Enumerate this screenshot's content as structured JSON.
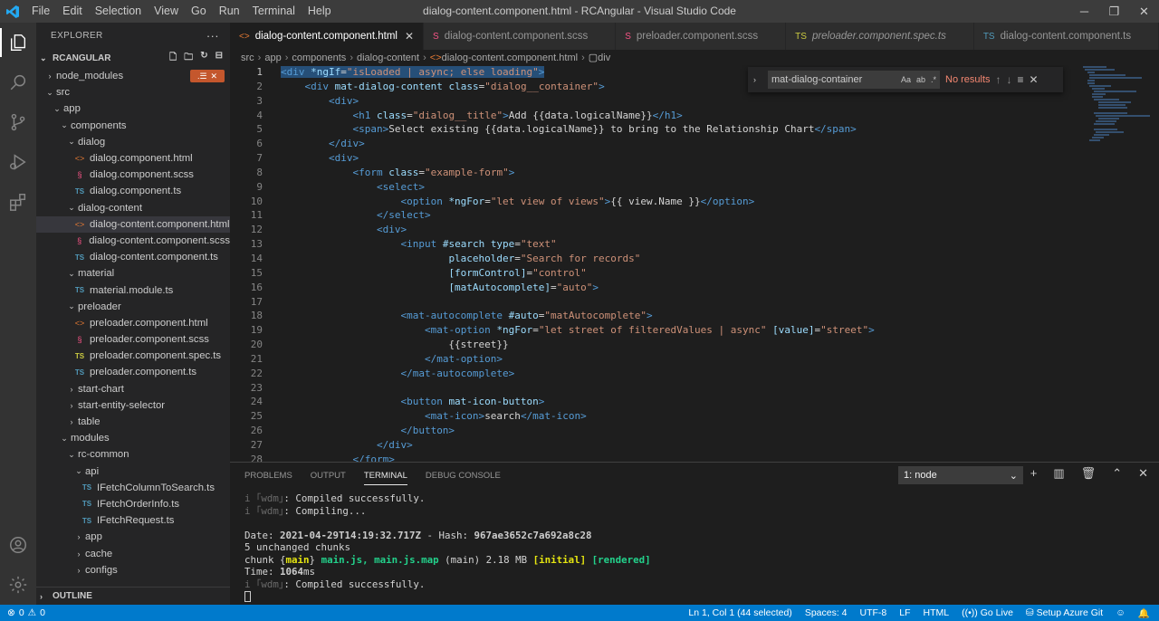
{
  "titlebar": {
    "menu": [
      "File",
      "Edit",
      "Selection",
      "View",
      "Go",
      "Run",
      "Terminal",
      "Help"
    ],
    "title": "dialog-content.component.html - RCAngular - Visual Studio Code"
  },
  "sidebar": {
    "header": "EXPLORER",
    "project": "RCANGULAR",
    "outline": "OUTLINE",
    "badge_count": "",
    "tree": [
      {
        "label": "node_modules",
        "indent": 0,
        "type": "folder",
        "open": false
      },
      {
        "label": "src",
        "indent": 0,
        "type": "folder",
        "open": true
      },
      {
        "label": "app",
        "indent": 1,
        "type": "folder",
        "open": true
      },
      {
        "label": "components",
        "indent": 2,
        "type": "folder",
        "open": true
      },
      {
        "label": "dialog",
        "indent": 3,
        "type": "folder",
        "open": true
      },
      {
        "label": "dialog.component.html",
        "indent": 4,
        "type": "html"
      },
      {
        "label": "dialog.component.scss",
        "indent": 4,
        "type": "scss"
      },
      {
        "label": "dialog.component.ts",
        "indent": 4,
        "type": "ts"
      },
      {
        "label": "dialog-content",
        "indent": 3,
        "type": "folder",
        "open": true
      },
      {
        "label": "dialog-content.component.html",
        "indent": 4,
        "type": "html",
        "selected": true
      },
      {
        "label": "dialog-content.component.scss",
        "indent": 4,
        "type": "scss"
      },
      {
        "label": "dialog-content.component.ts",
        "indent": 4,
        "type": "ts"
      },
      {
        "label": "material",
        "indent": 3,
        "type": "folder",
        "open": true
      },
      {
        "label": "material.module.ts",
        "indent": 4,
        "type": "ts"
      },
      {
        "label": "preloader",
        "indent": 3,
        "type": "folder",
        "open": true
      },
      {
        "label": "preloader.component.html",
        "indent": 4,
        "type": "html"
      },
      {
        "label": "preloader.component.scss",
        "indent": 4,
        "type": "scss"
      },
      {
        "label": "preloader.component.spec.ts",
        "indent": 4,
        "type": "spec"
      },
      {
        "label": "preloader.component.ts",
        "indent": 4,
        "type": "ts"
      },
      {
        "label": "start-chart",
        "indent": 3,
        "type": "folder",
        "open": false
      },
      {
        "label": "start-entity-selector",
        "indent": 3,
        "type": "folder",
        "open": false
      },
      {
        "label": "table",
        "indent": 3,
        "type": "folder",
        "open": false
      },
      {
        "label": "modules",
        "indent": 2,
        "type": "folder",
        "open": true
      },
      {
        "label": "rc-common",
        "indent": 3,
        "type": "folder",
        "open": true
      },
      {
        "label": "api",
        "indent": 4,
        "type": "folder",
        "open": true
      },
      {
        "label": "IFetchColumnToSearch.ts",
        "indent": 5,
        "type": "ts"
      },
      {
        "label": "IFetchOrderInfo.ts",
        "indent": 5,
        "type": "ts"
      },
      {
        "label": "IFetchRequest.ts",
        "indent": 5,
        "type": "ts"
      },
      {
        "label": "app",
        "indent": 4,
        "type": "folder",
        "open": false
      },
      {
        "label": "cache",
        "indent": 4,
        "type": "folder",
        "open": false
      },
      {
        "label": "configs",
        "indent": 4,
        "type": "folder",
        "open": false
      }
    ]
  },
  "tabs": [
    {
      "label": "dialog-content.component.html",
      "icon": "<>",
      "kind": "html",
      "active": true
    },
    {
      "label": "dialog-content.component.scss",
      "icon": "S",
      "kind": "scss"
    },
    {
      "label": "preloader.component.scss",
      "icon": "S",
      "kind": "scss"
    },
    {
      "label": "preloader.component.spec.ts",
      "icon": "TS",
      "kind": "spec",
      "italic": true
    },
    {
      "label": "dialog-content.component.ts",
      "icon": "TS",
      "kind": "ts"
    }
  ],
  "breadcrumb": [
    "src",
    "app",
    "components",
    "dialog-content",
    "dialog-content.component.html",
    "div"
  ],
  "find": {
    "query": "mat-dialog-container",
    "result": "No results"
  },
  "editor": {
    "current_line": 1,
    "lines": [
      [
        [
          "tag",
          "<div"
        ],
        [
          "txt",
          " "
        ],
        [
          "attr",
          "*ngIf"
        ],
        [
          "txt",
          "="
        ],
        [
          "str",
          "\"isLoaded | async; else loading\""
        ],
        [
          "tag",
          ">"
        ]
      ],
      [
        [
          "txt",
          "    "
        ],
        [
          "tag",
          "<div"
        ],
        [
          "txt",
          " "
        ],
        [
          "attr",
          "mat-dialog-content"
        ],
        [
          "txt",
          " "
        ],
        [
          "attr",
          "class"
        ],
        [
          "txt",
          "="
        ],
        [
          "str",
          "\"dialog__container\""
        ],
        [
          "tag",
          ">"
        ]
      ],
      [
        [
          "txt",
          "        "
        ],
        [
          "tag",
          "<div>"
        ]
      ],
      [
        [
          "txt",
          "            "
        ],
        [
          "tag",
          "<h1"
        ],
        [
          "txt",
          " "
        ],
        [
          "attr",
          "class"
        ],
        [
          "txt",
          "="
        ],
        [
          "str",
          "\"dialog__title\""
        ],
        [
          "tag",
          ">"
        ],
        [
          "txt",
          "Add {{data.logicalName}}"
        ],
        [
          "tag",
          "</h1>"
        ]
      ],
      [
        [
          "txt",
          "            "
        ],
        [
          "tag",
          "<span>"
        ],
        [
          "txt",
          "Select existing {{data.logicalName}} to bring to the Relationship Chart"
        ],
        [
          "tag",
          "</span>"
        ]
      ],
      [
        [
          "txt",
          "        "
        ],
        [
          "tag",
          "</div>"
        ]
      ],
      [
        [
          "txt",
          "        "
        ],
        [
          "tag",
          "<div>"
        ]
      ],
      [
        [
          "txt",
          "            "
        ],
        [
          "tag",
          "<form"
        ],
        [
          "txt",
          " "
        ],
        [
          "attr",
          "class"
        ],
        [
          "txt",
          "="
        ],
        [
          "str",
          "\"example-form\""
        ],
        [
          "tag",
          ">"
        ]
      ],
      [
        [
          "txt",
          "                "
        ],
        [
          "tag",
          "<select>"
        ]
      ],
      [
        [
          "txt",
          "                    "
        ],
        [
          "tag",
          "<option"
        ],
        [
          "txt",
          " "
        ],
        [
          "attr",
          "*ngFor"
        ],
        [
          "txt",
          "="
        ],
        [
          "str",
          "\"let view of views\""
        ],
        [
          "tag",
          ">"
        ],
        [
          "txt",
          "{{ view.Name }}"
        ],
        [
          "tag",
          "</option>"
        ]
      ],
      [
        [
          "txt",
          "                "
        ],
        [
          "tag",
          "</select>"
        ]
      ],
      [
        [
          "txt",
          "                "
        ],
        [
          "tag",
          "<div>"
        ]
      ],
      [
        [
          "txt",
          "                    "
        ],
        [
          "tag",
          "<input"
        ],
        [
          "txt",
          " "
        ],
        [
          "attr",
          "#search"
        ],
        [
          "txt",
          " "
        ],
        [
          "attr",
          "type"
        ],
        [
          "txt",
          "="
        ],
        [
          "str",
          "\"text\""
        ]
      ],
      [
        [
          "txt",
          "                            "
        ],
        [
          "attr",
          "placeholder"
        ],
        [
          "txt",
          "="
        ],
        [
          "str",
          "\"Search for records\""
        ]
      ],
      [
        [
          "txt",
          "                            "
        ],
        [
          "attr",
          "[formControl]"
        ],
        [
          "txt",
          "="
        ],
        [
          "str",
          "\"control\""
        ]
      ],
      [
        [
          "txt",
          "                            "
        ],
        [
          "attr",
          "[matAutocomplete]"
        ],
        [
          "txt",
          "="
        ],
        [
          "str",
          "\"auto\""
        ],
        [
          "tag",
          ">"
        ]
      ],
      [
        [
          "txt",
          ""
        ]
      ],
      [
        [
          "txt",
          "                    "
        ],
        [
          "tag",
          "<mat-autocomplete"
        ],
        [
          "txt",
          " "
        ],
        [
          "attr",
          "#auto"
        ],
        [
          "txt",
          "="
        ],
        [
          "str",
          "\"matAutocomplete\""
        ],
        [
          "tag",
          ">"
        ]
      ],
      [
        [
          "txt",
          "                        "
        ],
        [
          "tag",
          "<mat-option"
        ],
        [
          "txt",
          " "
        ],
        [
          "attr",
          "*ngFor"
        ],
        [
          "txt",
          "="
        ],
        [
          "str",
          "\"let street of filteredValues | async\""
        ],
        [
          "txt",
          " "
        ],
        [
          "attr",
          "[value]"
        ],
        [
          "txt",
          "="
        ],
        [
          "str",
          "\"street\""
        ],
        [
          "tag",
          ">"
        ]
      ],
      [
        [
          "txt",
          "                            {{street}}"
        ]
      ],
      [
        [
          "txt",
          "                        "
        ],
        [
          "tag",
          "</mat-option>"
        ]
      ],
      [
        [
          "txt",
          "                    "
        ],
        [
          "tag",
          "</mat-autocomplete>"
        ]
      ],
      [
        [
          "txt",
          ""
        ]
      ],
      [
        [
          "txt",
          "                    "
        ],
        [
          "tag",
          "<button"
        ],
        [
          "txt",
          " "
        ],
        [
          "attr",
          "mat-icon-button"
        ],
        [
          "tag",
          ">"
        ]
      ],
      [
        [
          "txt",
          "                        "
        ],
        [
          "tag",
          "<mat-icon>"
        ],
        [
          "txt",
          "search"
        ],
        [
          "tag",
          "</mat-icon>"
        ]
      ],
      [
        [
          "txt",
          "                    "
        ],
        [
          "tag",
          "</button>"
        ]
      ],
      [
        [
          "txt",
          "                "
        ],
        [
          "tag",
          "</div>"
        ]
      ],
      [
        [
          "txt",
          "            "
        ],
        [
          "tag",
          "</form>"
        ]
      ]
    ]
  },
  "panel": {
    "tabs": [
      "PROBLEMS",
      "OUTPUT",
      "TERMINAL",
      "DEBUG CONSOLE"
    ],
    "active_tab": "TERMINAL",
    "terminal_select": "1: node",
    "terminal": [
      [
        [
          "dim",
          "i "
        ],
        [
          "dim",
          "｢wdm｣"
        ],
        [
          "txt",
          ": Compiled successfully."
        ]
      ],
      [
        [
          "dim",
          "i "
        ],
        [
          "dim",
          "｢wdm｣"
        ],
        [
          "txt",
          ": Compiling..."
        ]
      ],
      [
        [
          "txt",
          ""
        ]
      ],
      [
        [
          "txt",
          "Date: "
        ],
        [
          "b",
          "2021-04-29T14:19:32.717Z"
        ],
        [
          "txt",
          " - Hash: "
        ],
        [
          "b",
          "967ae3652c7a692a8c28"
        ]
      ],
      [
        [
          "txt",
          "5 unchanged chunks"
        ]
      ],
      [
        [
          "txt",
          "chunk "
        ],
        [
          "txt",
          "{"
        ],
        [
          "yl",
          "main"
        ],
        [
          "txt",
          "} "
        ],
        [
          "gr",
          "main.js, main.js.map"
        ],
        [
          "txt",
          " (main) 2.18 MB "
        ],
        [
          "yl",
          "[initial]"
        ],
        [
          "txt",
          " "
        ],
        [
          "gr",
          "[rendered]"
        ]
      ],
      [
        [
          "txt",
          "Time: "
        ],
        [
          "b",
          "1064"
        ],
        [
          "txt",
          "ms"
        ]
      ],
      [
        [
          "dim",
          "i "
        ],
        [
          "dim",
          "｢wdm｣"
        ],
        [
          "txt",
          ": Compiled successfully."
        ]
      ]
    ]
  },
  "statusbar": {
    "errors": "0",
    "warnings": "0",
    "position": "Ln 1, Col 1 (44 selected)",
    "spaces": "Spaces: 4",
    "encoding": "UTF-8",
    "eol": "LF",
    "language": "HTML",
    "golive": "Go Live",
    "azure": "Setup Azure Git"
  },
  "colors": {
    "accent": "#007acc",
    "titlebar": "#3c3c3c",
    "sidebar": "#252526",
    "editor": "#1e1e1e",
    "selection": "#264f78"
  }
}
